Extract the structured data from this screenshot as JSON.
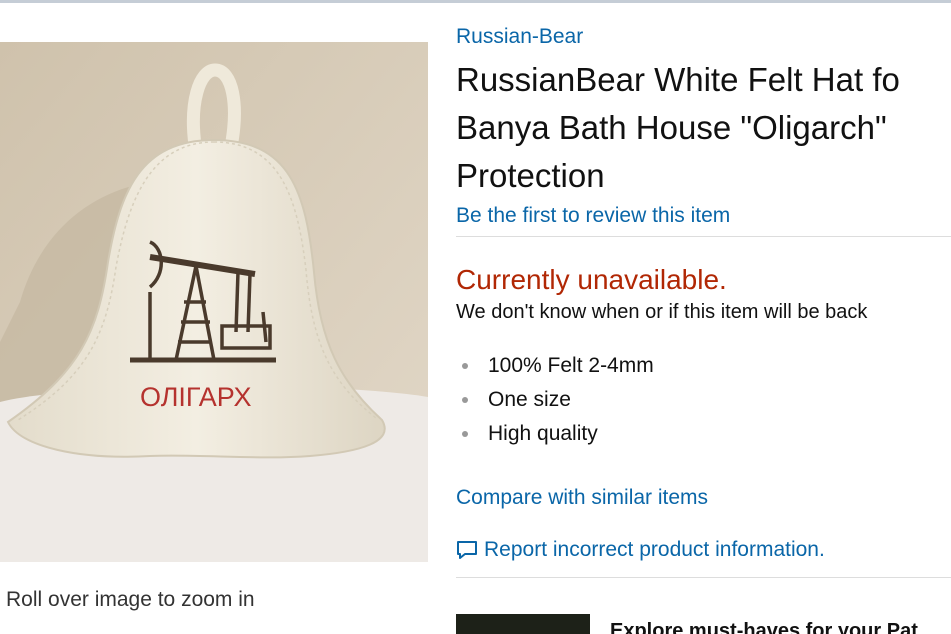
{
  "product": {
    "brand": "Russian-Bear",
    "title_lines": [
      "RussianBear White Felt Hat fo",
      "Banya Bath House \"Oligarch\"",
      "Protection"
    ],
    "review_link": "Be the first to review this item",
    "availability": "Currently unavailable.",
    "availability_note": "We don't know when or if this item will be back",
    "features": [
      "100% Felt 2-4mm",
      "One size",
      "High quality"
    ],
    "compare_link": "Compare with similar items",
    "report_link": "Report incorrect product information."
  },
  "image": {
    "hat_embroidery_text": "ОЛІГАРХ",
    "zoom_hint": "Roll over image to zoom in"
  },
  "promo": {
    "text": "Explore must-haves for your Pat"
  },
  "colors": {
    "link": "#0a66a8",
    "unavailable": "#b12704",
    "embroidery_red": "#b5322e",
    "embroidery_brown": "#4a3a2c"
  },
  "icons": {
    "report": "speech-bubble-icon"
  }
}
